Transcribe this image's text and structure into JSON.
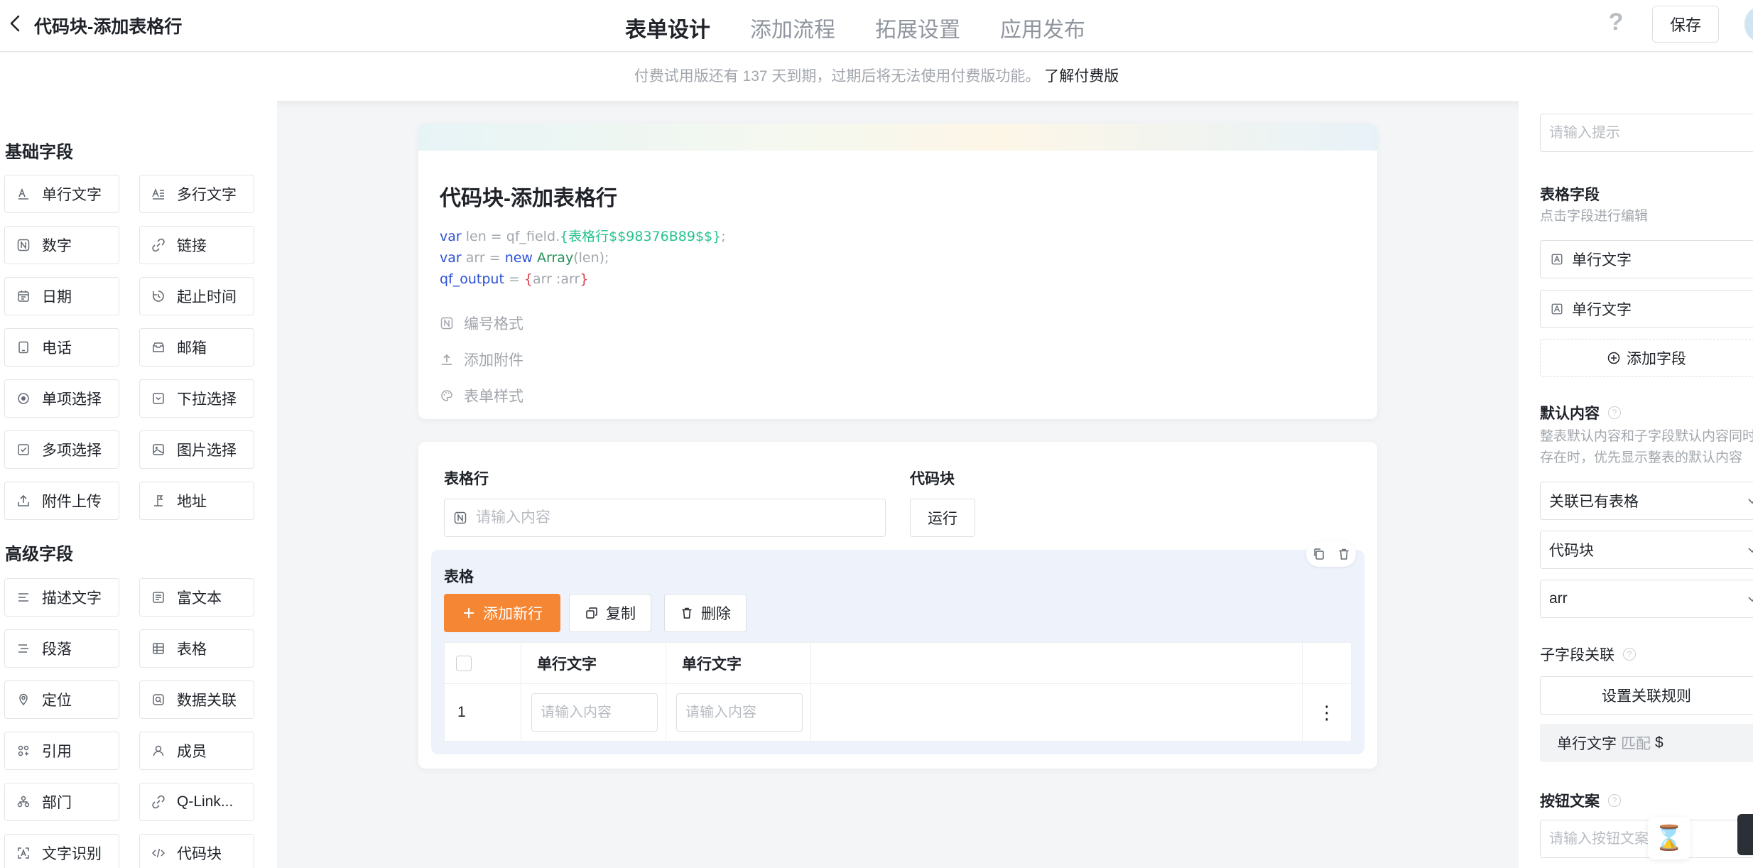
{
  "header": {
    "title": "代码块-添加表格行",
    "tabs": [
      {
        "label": "表单设计",
        "active": true
      },
      {
        "label": "添加流程",
        "active": false
      },
      {
        "label": "拓展设置",
        "active": false
      },
      {
        "label": "应用发布",
        "active": false
      }
    ],
    "help_glyph": "?",
    "save_label": "保存"
  },
  "notice": {
    "text": "付费试用版还有 137 天到期，过期后将无法使用付费版功能。",
    "link": "了解付费版"
  },
  "palette": {
    "basic_title": "基础字段",
    "basic": [
      {
        "label": "单行文字",
        "icon": "text-icon"
      },
      {
        "label": "多行文字",
        "icon": "multiline-text-icon"
      },
      {
        "label": "数字",
        "icon": "number-icon"
      },
      {
        "label": "链接",
        "icon": "link-icon"
      },
      {
        "label": "日期",
        "icon": "calendar-icon"
      },
      {
        "label": "起止时间",
        "icon": "time-range-icon"
      },
      {
        "label": "电话",
        "icon": "phone-icon"
      },
      {
        "label": "邮箱",
        "icon": "mail-icon"
      },
      {
        "label": "单项选择",
        "icon": "radio-icon"
      },
      {
        "label": "下拉选择",
        "icon": "dropdown-icon"
      },
      {
        "label": "多项选择",
        "icon": "checkbox-icon"
      },
      {
        "label": "图片选择",
        "icon": "image-icon"
      },
      {
        "label": "附件上传",
        "icon": "upload-icon"
      },
      {
        "label": "地址",
        "icon": "address-icon"
      }
    ],
    "advanced_title": "高级字段",
    "advanced": [
      {
        "label": "描述文字",
        "icon": "description-icon"
      },
      {
        "label": "富文本",
        "icon": "rich-text-icon"
      },
      {
        "label": "段落",
        "icon": "paragraph-icon"
      },
      {
        "label": "表格",
        "icon": "table-icon"
      },
      {
        "label": "定位",
        "icon": "location-icon"
      },
      {
        "label": "数据关联",
        "icon": "data-link-icon"
      },
      {
        "label": "引用",
        "icon": "reference-icon"
      },
      {
        "label": "成员",
        "icon": "member-icon"
      },
      {
        "label": "部门",
        "icon": "department-icon"
      },
      {
        "label": "Q-Link...",
        "icon": "qlink-icon"
      },
      {
        "label": "文字识别",
        "icon": "ocr-icon"
      },
      {
        "label": "代码块",
        "icon": "code-icon"
      }
    ]
  },
  "form": {
    "title": "代码块-添加表格行",
    "code": {
      "l1_kw": "var",
      "l1_a": " len = qf_field.",
      "l1_ref": "{表格行$$98376B89$$}",
      "l1_b": ";",
      "l2_kw": "var",
      "l2_a": " arr = ",
      "l2_new": "new",
      "l2_sp": " ",
      "l2_ty": "Array",
      "l2_b": "(len);",
      "l3_kw": "qf_output",
      "l3_a": " = ",
      "l3_br1": "{",
      "l3_b": "arr :arr",
      "l3_br2": "}"
    },
    "options": [
      {
        "label": "编号格式",
        "icon": "number-format-icon"
      },
      {
        "label": "添加附件",
        "icon": "upload-icon"
      },
      {
        "label": "表单样式",
        "icon": "palette-icon"
      }
    ]
  },
  "fields_card": {
    "row_label": "表格行",
    "row_placeholder": "请输入内容",
    "code_label": "代码块",
    "run_label": "运行",
    "table": {
      "title": "表格",
      "add_label": "添加新行",
      "copy_label": "复制",
      "delete_label": "删除",
      "columns": [
        "单行文字",
        "单行文字"
      ],
      "rows": [
        {
          "index": "1",
          "placeholders": [
            "请输入内容",
            "请输入内容"
          ]
        }
      ],
      "row_menu_glyph": "⋮"
    }
  },
  "right_panel": {
    "hint_placeholder": "请输入提示",
    "table_fields_label": "表格字段",
    "table_fields_sub": "点击字段进行编辑",
    "table_fields": [
      "单行文字",
      "单行文字"
    ],
    "add_field_label": "添加字段",
    "default_label": "默认内容",
    "default_desc_1": "整表默认内容和子字段默认内容同时",
    "default_desc_2": "存在时，优先显示整表的默认内容",
    "selects": [
      "关联已有表格",
      "代码块",
      "arr"
    ],
    "child_link_label": "子字段关联",
    "set_rule_label": "设置关联规则",
    "rule": {
      "field": "单行文字",
      "match": "匹配",
      "value": "$"
    },
    "button_text_label": "按钮文案",
    "button_text_placeholder": "请输入按钮文案"
  },
  "floating": {
    "hourglass": "⌛"
  },
  "colors": {
    "accent": "#f58634",
    "tab_indicator": "#f5891f",
    "keyword": "#2b50d6",
    "ref": "#28c28f"
  }
}
